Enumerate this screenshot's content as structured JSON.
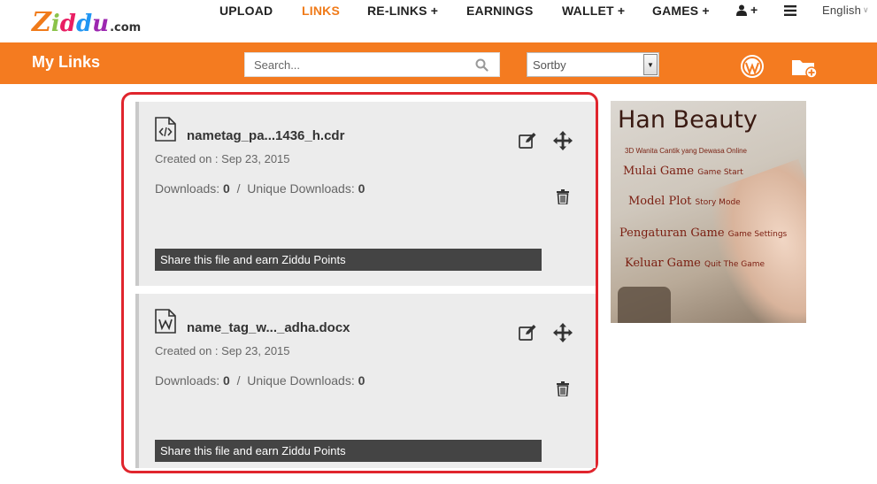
{
  "brand": {
    "logo_main": "Ziddu",
    "logo_suffix": ".com"
  },
  "nav": {
    "upload": "UPLOAD",
    "links": "LINKS",
    "relinks": "RE-LINKS +",
    "earnings": "EARNINGS",
    "wallet": "WALLET +",
    "games": "GAMES +",
    "user": "+",
    "language": "English",
    "active_color": "#f47b20"
  },
  "toolbar": {
    "title": "My Links",
    "search_placeholder": "Search...",
    "sort_label": "Sortby",
    "bar_color": "#f47b20"
  },
  "cards": [
    {
      "file_type": "code",
      "name": "nametag_pa...1436_h.cdr",
      "created": "Created on : Sep 23, 2015",
      "downloads_label": "Downloads:",
      "downloads": "0",
      "separator": "/",
      "unique_label": "Unique Downloads:",
      "unique": "0",
      "share": "Share this file and earn Ziddu Points"
    },
    {
      "file_type": "word",
      "name": "name_tag_w..._adha.docx",
      "created": "Created on : Sep 23, 2015",
      "downloads_label": "Downloads:",
      "downloads": "0",
      "separator": "/",
      "unique_label": "Unique Downloads:",
      "unique": "0",
      "share": "Share this file and earn Ziddu Points"
    }
  ],
  "ad": {
    "title": "Han Beauty",
    "subtitle": "3D Wanita Cantik yang Dewasa Online",
    "items": [
      {
        "main": "Mulai Game",
        "sub": "Game Start"
      },
      {
        "main": "Model Plot",
        "sub": "Story Mode"
      },
      {
        "main": "Pengaturan Game",
        "sub": "Game Settings"
      },
      {
        "main": "Keluar Game",
        "sub": "Quit The Game"
      }
    ]
  }
}
